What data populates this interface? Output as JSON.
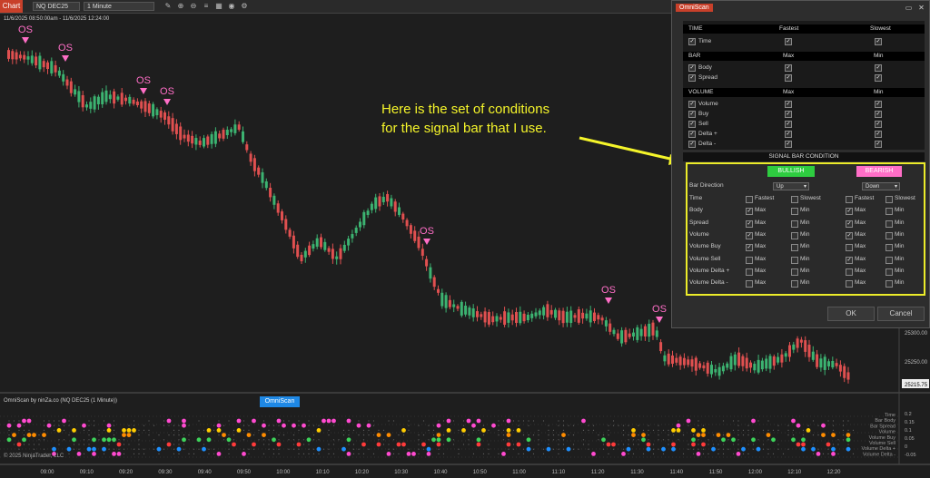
{
  "toolbar": {
    "chart_tab": "Chart",
    "instrument": "NQ DEC25",
    "interval": "1 Minute",
    "icons": [
      "draw-icon",
      "zoom-in-icon",
      "zoom-out-icon",
      "properties-icon",
      "grid-icon",
      "camera-icon",
      "settings-icon"
    ]
  },
  "chart": {
    "range": "11/6/2025 08:50:00am - 11/6/2025 12:24:00",
    "signal_label": "OS",
    "price_labels": [
      "25300.00",
      "25250.00",
      "25215.75"
    ],
    "time_labels": [
      "09:00",
      "09:10",
      "09:20",
      "09:30",
      "09:40",
      "09:50",
      "10:00",
      "10:10",
      "10:20",
      "10:30",
      "10:40",
      "10:50",
      "11:00",
      "11:10",
      "11:20",
      "11:30",
      "11:40",
      "11:50",
      "12:00",
      "12:10",
      "12:20"
    ],
    "colors": {
      "bull": "#3cb371",
      "bear": "#e05050",
      "signal": "#ff6ec7"
    }
  },
  "indicator": {
    "pane_label": "OmniScan by ninZa.co (NQ DEC25 (1 Minute))",
    "tag": "OmniScan",
    "row_labels": [
      "Time",
      "Bar Body",
      "Bar Spread",
      "Volume",
      "Volume Buy",
      "Volume Sell",
      "Volume Delta +",
      "Volume Delta -"
    ],
    "y_ticks": [
      "0.2",
      "0.15",
      "0.1",
      "0.05",
      "0",
      "-0.05"
    ],
    "copyright": "© 2025 NinjaTrader, LLC"
  },
  "dialog": {
    "title": "OmniScan",
    "time": {
      "head": "TIME",
      "col1": "Fastest",
      "col2": "Slowest",
      "rows": [
        "Time"
      ]
    },
    "bar": {
      "head": "BAR",
      "col1": "Max",
      "col2": "Min",
      "rows": [
        "Body",
        "Spread"
      ]
    },
    "volume": {
      "head": "VOLUME",
      "col1": "Max",
      "col2": "Min",
      "rows": [
        "Volume",
        "Buy",
        "Sell",
        "Delta +",
        "Delta -"
      ]
    },
    "signal_head": "SIGNAL BAR CONDITION",
    "bullish": "BULLISH",
    "bearish": "BEARISH",
    "bar_direction": {
      "label": "Bar Direction",
      "bull": "Up",
      "bear": "Down"
    },
    "conditions": [
      {
        "label": "Time",
        "a": "Fastest",
        "b": "Slowest",
        "bull": [
          false,
          false
        ],
        "bear": [
          false,
          false
        ]
      },
      {
        "label": "Body",
        "a": "Max",
        "b": "Min",
        "bull": [
          true,
          false
        ],
        "bear": [
          true,
          false
        ]
      },
      {
        "label": "Spread",
        "a": "Max",
        "b": "Min",
        "bull": [
          true,
          false
        ],
        "bear": [
          true,
          false
        ]
      },
      {
        "label": "Volume",
        "a": "Max",
        "b": "Min",
        "bull": [
          true,
          false
        ],
        "bear": [
          true,
          false
        ]
      },
      {
        "label": "Volume Buy",
        "a": "Max",
        "b": "Min",
        "bull": [
          true,
          false
        ],
        "bear": [
          false,
          false
        ]
      },
      {
        "label": "Volume Sell",
        "a": "Max",
        "b": "Min",
        "bull": [
          false,
          false
        ],
        "bear": [
          true,
          false
        ]
      },
      {
        "label": "Volume Delta +",
        "a": "Max",
        "b": "Min",
        "bull": [
          false,
          false
        ],
        "bear": [
          false,
          false
        ]
      },
      {
        "label": "Volume Delta -",
        "a": "Max",
        "b": "Min",
        "bull": [
          false,
          false
        ],
        "bear": [
          false,
          false
        ]
      }
    ],
    "ok": "OK",
    "cancel": "Cancel"
  },
  "annotation": {
    "line1": "Here is the set of conditions",
    "line2": "for the signal bar that I use."
  }
}
